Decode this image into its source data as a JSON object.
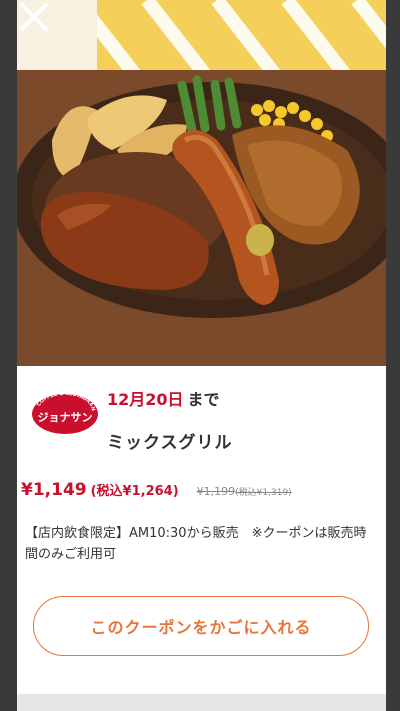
{
  "coupon": {
    "deadline_date": "12月20日",
    "deadline_suffix": "まで",
    "product_name": "ミックスグリル",
    "price": "¥1,149",
    "price_tax_included": "(税込¥1,264)",
    "original_price": "¥1,199",
    "original_price_tax_included": "(税込¥1,319)",
    "description": "【店内飲食限定】AM10:30から販売　※クーポンは販売時間のみご利用可",
    "add_button_label": "このクーポンをかごに入れる"
  },
  "brand": {
    "logo_text_top": "COFFEE & RESTAURANT",
    "logo_text_main": "ジョナサン"
  },
  "icons": {
    "close": "close-icon"
  },
  "colors": {
    "accent_red": "#c8102e",
    "button_orange": "#e8753a"
  }
}
